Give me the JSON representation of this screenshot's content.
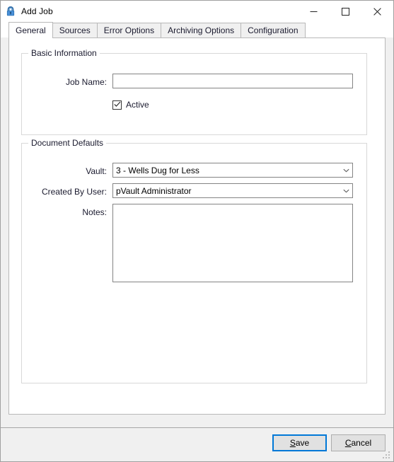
{
  "window": {
    "title": "Add Job",
    "icon": "lock-icon",
    "caption_buttons": [
      {
        "name": "minimize",
        "glyph": "minimize-icon"
      },
      {
        "name": "maximize",
        "glyph": "maximize-icon"
      },
      {
        "name": "close",
        "glyph": "close-icon"
      }
    ]
  },
  "tabs": [
    {
      "label": "General",
      "selected": true
    },
    {
      "label": "Sources",
      "selected": false
    },
    {
      "label": "Error Options",
      "selected": false
    },
    {
      "label": "Archiving Options",
      "selected": false
    },
    {
      "label": "Configuration",
      "selected": false
    }
  ],
  "groups": {
    "basic_information": {
      "title": "Basic Information",
      "job_name_label": "Job Name:",
      "job_name_value": "",
      "job_name_placeholder": "",
      "active_label": "Active",
      "active_checked": true,
      "checkmark": "check-icon"
    },
    "document_defaults": {
      "title": "Document Defaults",
      "vault_label": "Vault:",
      "vault_value": "3 - Wells Dug for Less",
      "created_by_user_label": "Created By User:",
      "created_by_user_value": "pVault  Administrator",
      "notes_label": "Notes:",
      "notes_value": "",
      "dropdown_icon": "chevron-down-icon"
    }
  },
  "footer": {
    "save_label_pre": "",
    "save_accel": "S",
    "save_label_post": "ave",
    "cancel_accel": "C",
    "cancel_label_post": "ancel",
    "resize_grip": "resize-grip-icon"
  },
  "colors": {
    "accent": "#0078d7",
    "window_bg": "#f0f0f0",
    "panel_bg": "#ffffff",
    "border": "#b8b8b8",
    "text": "#1a1a2e"
  }
}
